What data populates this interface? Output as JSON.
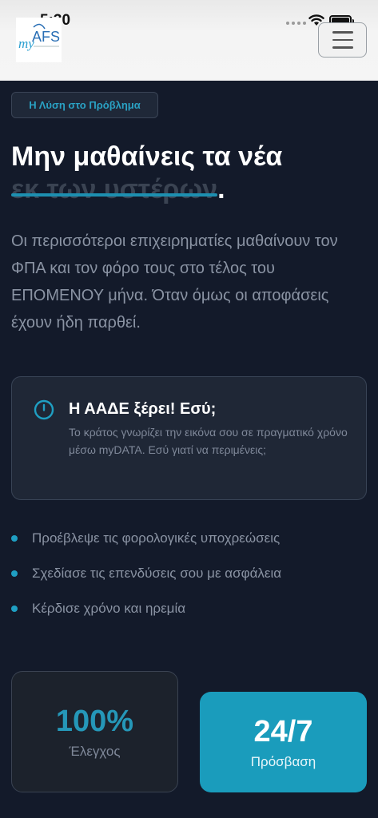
{
  "status_bar": {
    "time": "5:30"
  },
  "header": {
    "logo_text": "myAFS",
    "menu_icon": "hamburger-menu-icon"
  },
  "hero": {
    "badge": "Η Λύση στο Πρόβλημα",
    "title_line1": "Μην μαθαίνεις τα νέα",
    "title_struck": "εκ των υστέρων",
    "title_period": ".",
    "lead": "Οι περισσότεροι επιχειρηματίες μαθαίνουν τον ΦΠΑ και τον φόρο τους στο τέλος του ΕΠΟΜΕΝΟΥ μήνα. Όταν όμως οι αποφάσεις έχουν ήδη παρθεί."
  },
  "card": {
    "icon": "clock-icon",
    "title": "Η ΑΑΔΕ ξέρει! Εσύ;",
    "text": "Το κράτος γνωρίζει την εικόνα σου σε πραγματικό χρόνο μέσω myDATA. Εσύ γιατί να περιμένεις;"
  },
  "bullets": [
    "Προέβλεψε τις φορολογικές υποχρεώσεις",
    "Σχεδίασε τις επενδύσεις σου με ασφάλεια",
    "Κέρδισε χρόνο και ηρεμία"
  ],
  "stats": [
    {
      "value": "100%",
      "label": "Έλεγχος"
    },
    {
      "value": "24/7",
      "label": "Πρόσβαση"
    }
  ],
  "colors": {
    "background": "#131a2a",
    "accent": "#1a9cbc",
    "header_bg": "#f4f4f4"
  }
}
